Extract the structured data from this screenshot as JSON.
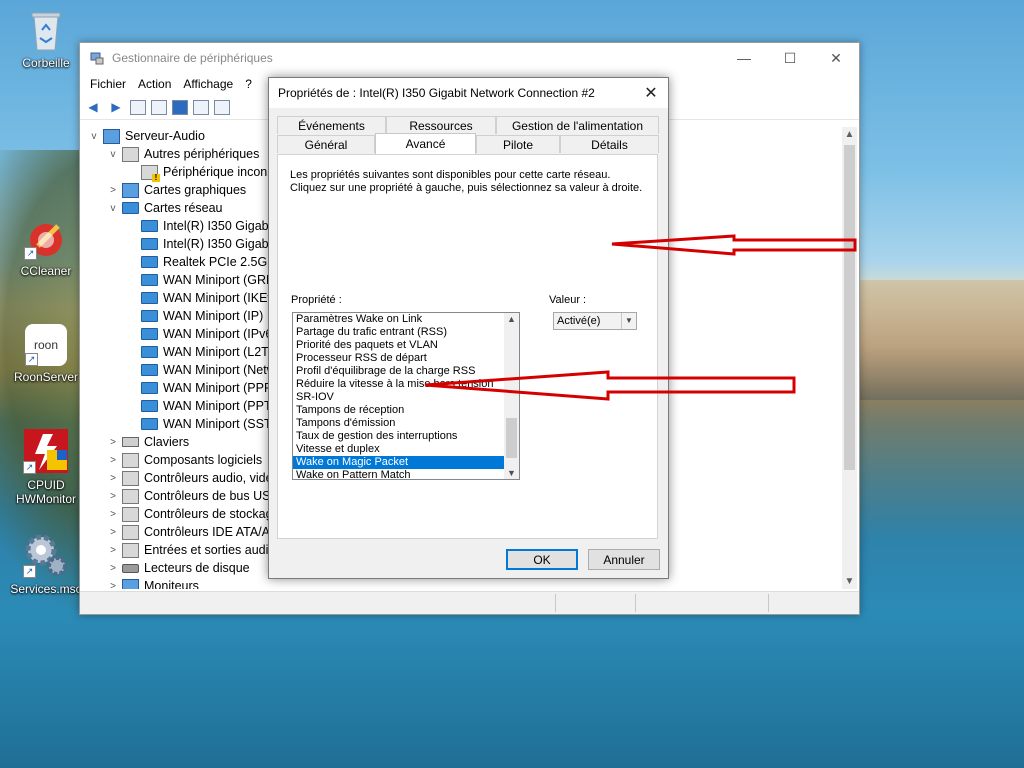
{
  "desktop": {
    "icons": [
      {
        "label": "Corbeille",
        "icon": "recycle-bin-icon"
      },
      {
        "label": "CCleaner",
        "icon": "ccleaner-icon"
      },
      {
        "label": "RoonServer",
        "icon": "roon-icon",
        "badge": "roon"
      },
      {
        "label": "CPUID HWMonitor",
        "icon": "hwmonitor-icon"
      },
      {
        "label": "Services.msc",
        "icon": "services-gear-icon"
      }
    ]
  },
  "device_manager": {
    "title": "Gestionnaire de périphériques",
    "menu": [
      "Fichier",
      "Action",
      "Affichage",
      "?"
    ],
    "controls": {
      "minimize": "—",
      "maximize": "☐",
      "close": "✕"
    },
    "tree": [
      {
        "text": "Serveur-Audio",
        "level": 0,
        "toggle": "v",
        "icon": "computer-icon"
      },
      {
        "text": "Autres périphériques",
        "level": 1,
        "toggle": "v",
        "icon": "unknown-device-icon"
      },
      {
        "text": "Périphérique inconn",
        "level": 2,
        "toggle": "",
        "icon": "warning-device-icon"
      },
      {
        "text": "Cartes graphiques",
        "level": 1,
        "toggle": ">",
        "icon": "display-adapter-icon"
      },
      {
        "text": "Cartes réseau",
        "level": 1,
        "toggle": "v",
        "icon": "network-adapter-icon"
      },
      {
        "text": "Intel(R) I350 Gigabit",
        "level": 2,
        "toggle": "",
        "icon": "network-adapter-icon"
      },
      {
        "text": "Intel(R) I350 Gigabit",
        "level": 2,
        "toggle": "",
        "icon": "network-adapter-icon"
      },
      {
        "text": "Realtek PCIe 2.5GbE",
        "level": 2,
        "toggle": "",
        "icon": "network-adapter-icon"
      },
      {
        "text": "WAN Miniport (GRE)",
        "level": 2,
        "toggle": "",
        "icon": "network-adapter-icon"
      },
      {
        "text": "WAN Miniport (IKEv",
        "level": 2,
        "toggle": "",
        "icon": "network-adapter-icon"
      },
      {
        "text": "WAN Miniport (IP)",
        "level": 2,
        "toggle": "",
        "icon": "network-adapter-icon"
      },
      {
        "text": "WAN Miniport (IPv6",
        "level": 2,
        "toggle": "",
        "icon": "network-adapter-icon"
      },
      {
        "text": "WAN Miniport (L2TP",
        "level": 2,
        "toggle": "",
        "icon": "network-adapter-icon"
      },
      {
        "text": "WAN Miniport (Netw",
        "level": 2,
        "toggle": "",
        "icon": "network-adapter-icon"
      },
      {
        "text": "WAN Miniport (PPPC",
        "level": 2,
        "toggle": "",
        "icon": "network-adapter-icon"
      },
      {
        "text": "WAN Miniport (PPTP",
        "level": 2,
        "toggle": "",
        "icon": "network-adapter-icon"
      },
      {
        "text": "WAN Miniport (SSTP",
        "level": 2,
        "toggle": "",
        "icon": "network-adapter-icon"
      },
      {
        "text": "Claviers",
        "level": 1,
        "toggle": ">",
        "icon": "keyboard-icon"
      },
      {
        "text": "Composants logiciels",
        "level": 1,
        "toggle": ">",
        "icon": "software-component-icon"
      },
      {
        "text": "Contrôleurs audio, vidéo",
        "level": 1,
        "toggle": ">",
        "icon": "audio-controller-icon"
      },
      {
        "text": "Contrôleurs de bus USB",
        "level": 1,
        "toggle": ">",
        "icon": "usb-controller-icon"
      },
      {
        "text": "Contrôleurs de stockage",
        "level": 1,
        "toggle": ">",
        "icon": "storage-controller-icon"
      },
      {
        "text": "Contrôleurs IDE ATA/AT",
        "level": 1,
        "toggle": ">",
        "icon": "ide-controller-icon"
      },
      {
        "text": "Entrées et sorties audio",
        "level": 1,
        "toggle": ">",
        "icon": "audio-io-icon"
      },
      {
        "text": "Lecteurs de disque",
        "level": 1,
        "toggle": ">",
        "icon": "disk-drive-icon"
      },
      {
        "text": "Moniteurs",
        "level": 1,
        "toggle": ">",
        "icon": "monitor-icon"
      }
    ]
  },
  "dialog": {
    "title": "Propriétés de : Intel(R) I350 Gigabit Network Connection #2",
    "tabs_row1": [
      "Événements",
      "Ressources",
      "Gestion de l'alimentation"
    ],
    "tabs_row2": [
      "Général",
      "Avancé",
      "Pilote",
      "Détails"
    ],
    "active_tab": "Avancé",
    "description": "Les propriétés suivantes sont disponibles pour cette carte réseau. Cliquez sur une propriété à gauche, puis sélectionnez sa valeur à droite.",
    "property_label": "Propriété :",
    "value_label": "Valeur :",
    "properties": [
      "Paramètres Wake on Link",
      "Partage du trafic entrant (RSS)",
      "Priorité des paquets et VLAN",
      "Processeur RSS de départ",
      "Profil d'équilibrage de la charge RSS",
      "Réduire la vitesse à la mise hors tension",
      "SR-IOV",
      "Tampons de réception",
      "Tampons d'émission",
      "Taux de gestion des interruptions",
      "Vitesse et duplex",
      "Wake on Magic Packet",
      "Wake on Pattern Match"
    ],
    "selected_property": "Wake on Magic Packet",
    "value": "Activé(e)",
    "ok_label": "OK",
    "cancel_label": "Annuler"
  },
  "annotation_color": "#d40000"
}
